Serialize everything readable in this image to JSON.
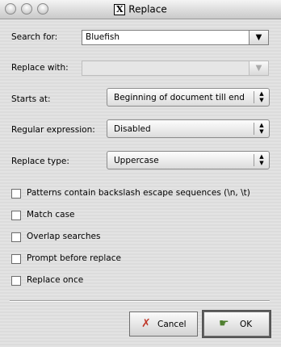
{
  "window": {
    "title": "Replace",
    "app_icon": "X"
  },
  "fields": {
    "search_label": "Search for:",
    "search_value": "Bluefish",
    "replace_label": "Replace with:",
    "replace_value": ""
  },
  "options": {
    "starts_at_label": "Starts at:",
    "starts_at_value": "Beginning of document till end",
    "regex_label": "Regular expression:",
    "regex_value": "Disabled",
    "replace_type_label": "Replace type:",
    "replace_type_value": "Uppercase"
  },
  "checkboxes": [
    {
      "label": "Patterns contain backslash escape sequences (\\n, \\t)",
      "checked": false
    },
    {
      "label": "Match case",
      "checked": false
    },
    {
      "label": "Overlap searches",
      "checked": false
    },
    {
      "label": "Prompt before replace",
      "checked": false
    },
    {
      "label": "Replace once",
      "checked": false
    }
  ],
  "buttons": {
    "cancel_label": "Cancel",
    "ok_label": "OK"
  }
}
